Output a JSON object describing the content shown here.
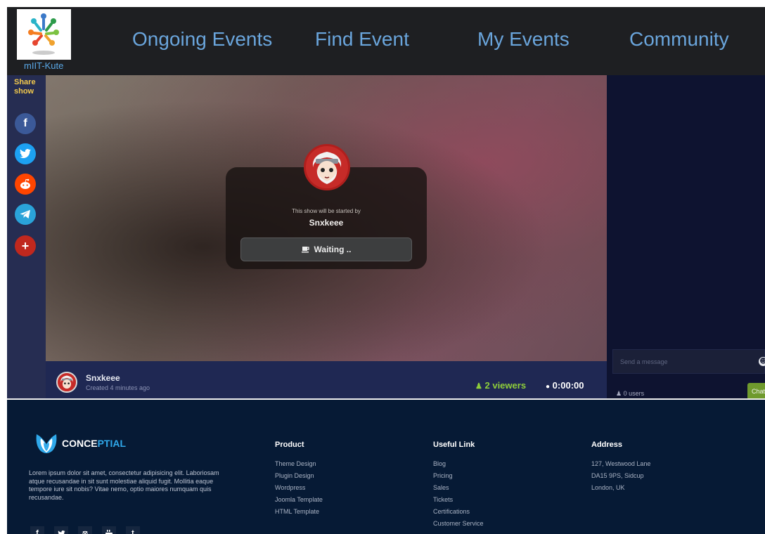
{
  "header": {
    "logo_text": "mIIT-Kute",
    "nav": [
      {
        "label": "Ongoing Events"
      },
      {
        "label": "Find Event"
      },
      {
        "label": "My Events"
      },
      {
        "label": "Community"
      }
    ]
  },
  "share": {
    "label": "Share show",
    "buttons": [
      {
        "name": "facebook-icon",
        "glyph": "f",
        "color": "#3b5998"
      },
      {
        "name": "twitter-icon",
        "glyph": "t",
        "color": "#1da1f2"
      },
      {
        "name": "reddit-icon",
        "glyph": "r",
        "color": "#ff4500"
      },
      {
        "name": "telegram-icon",
        "glyph": "➤",
        "color": "#2aa3d9"
      },
      {
        "name": "more-share-icon",
        "glyph": "+",
        "color": "#c0281e"
      }
    ]
  },
  "stage": {
    "subtitle": "This show will be started by",
    "host": "Snxkeee",
    "waiting_label": "Waiting .."
  },
  "info": {
    "host_name": "Snxkeee",
    "created": "Created 4 minutes ago",
    "viewers": "2 viewers",
    "timer": "0:00:00"
  },
  "chat": {
    "placeholder": "Send a message",
    "users": "0 users",
    "button": "Chat"
  },
  "footer": {
    "brand_main": "CONCE",
    "brand_accent": "PTIAL",
    "about": "Lorem ipsum dolor sit amet, consectetur adipisicing elit. Laboriosam atque recusandae in sit sunt molestiae aliquid fugit. Mollitia eaque tempore iure sit nobis? Vitae nemo, optio maiores numquam quis recusandae.",
    "columns": [
      {
        "title": "Product",
        "items": [
          "Theme Design",
          "Plugin Design",
          "Wordpress",
          "Joomla Template",
          "HTML Template"
        ]
      },
      {
        "title": "Useful Link",
        "items": [
          "Blog",
          "Pricing",
          "Sales",
          "Tickets",
          "Certifications",
          "Customer Service"
        ]
      },
      {
        "title": "Address",
        "items": [
          "127, Westwood Lane",
          "DA15 9PS, Sidcup",
          "London, UK"
        ]
      }
    ],
    "social": [
      {
        "name": "footer-facebook-icon",
        "glyph": "f"
      },
      {
        "name": "footer-twitter-icon",
        "glyph": "✓"
      },
      {
        "name": "footer-dribbble-icon",
        "glyph": "⊛"
      },
      {
        "name": "footer-youtube-icon",
        "glyph": "▶"
      },
      {
        "name": "footer-tumblr-icon",
        "glyph": "t"
      }
    ]
  }
}
